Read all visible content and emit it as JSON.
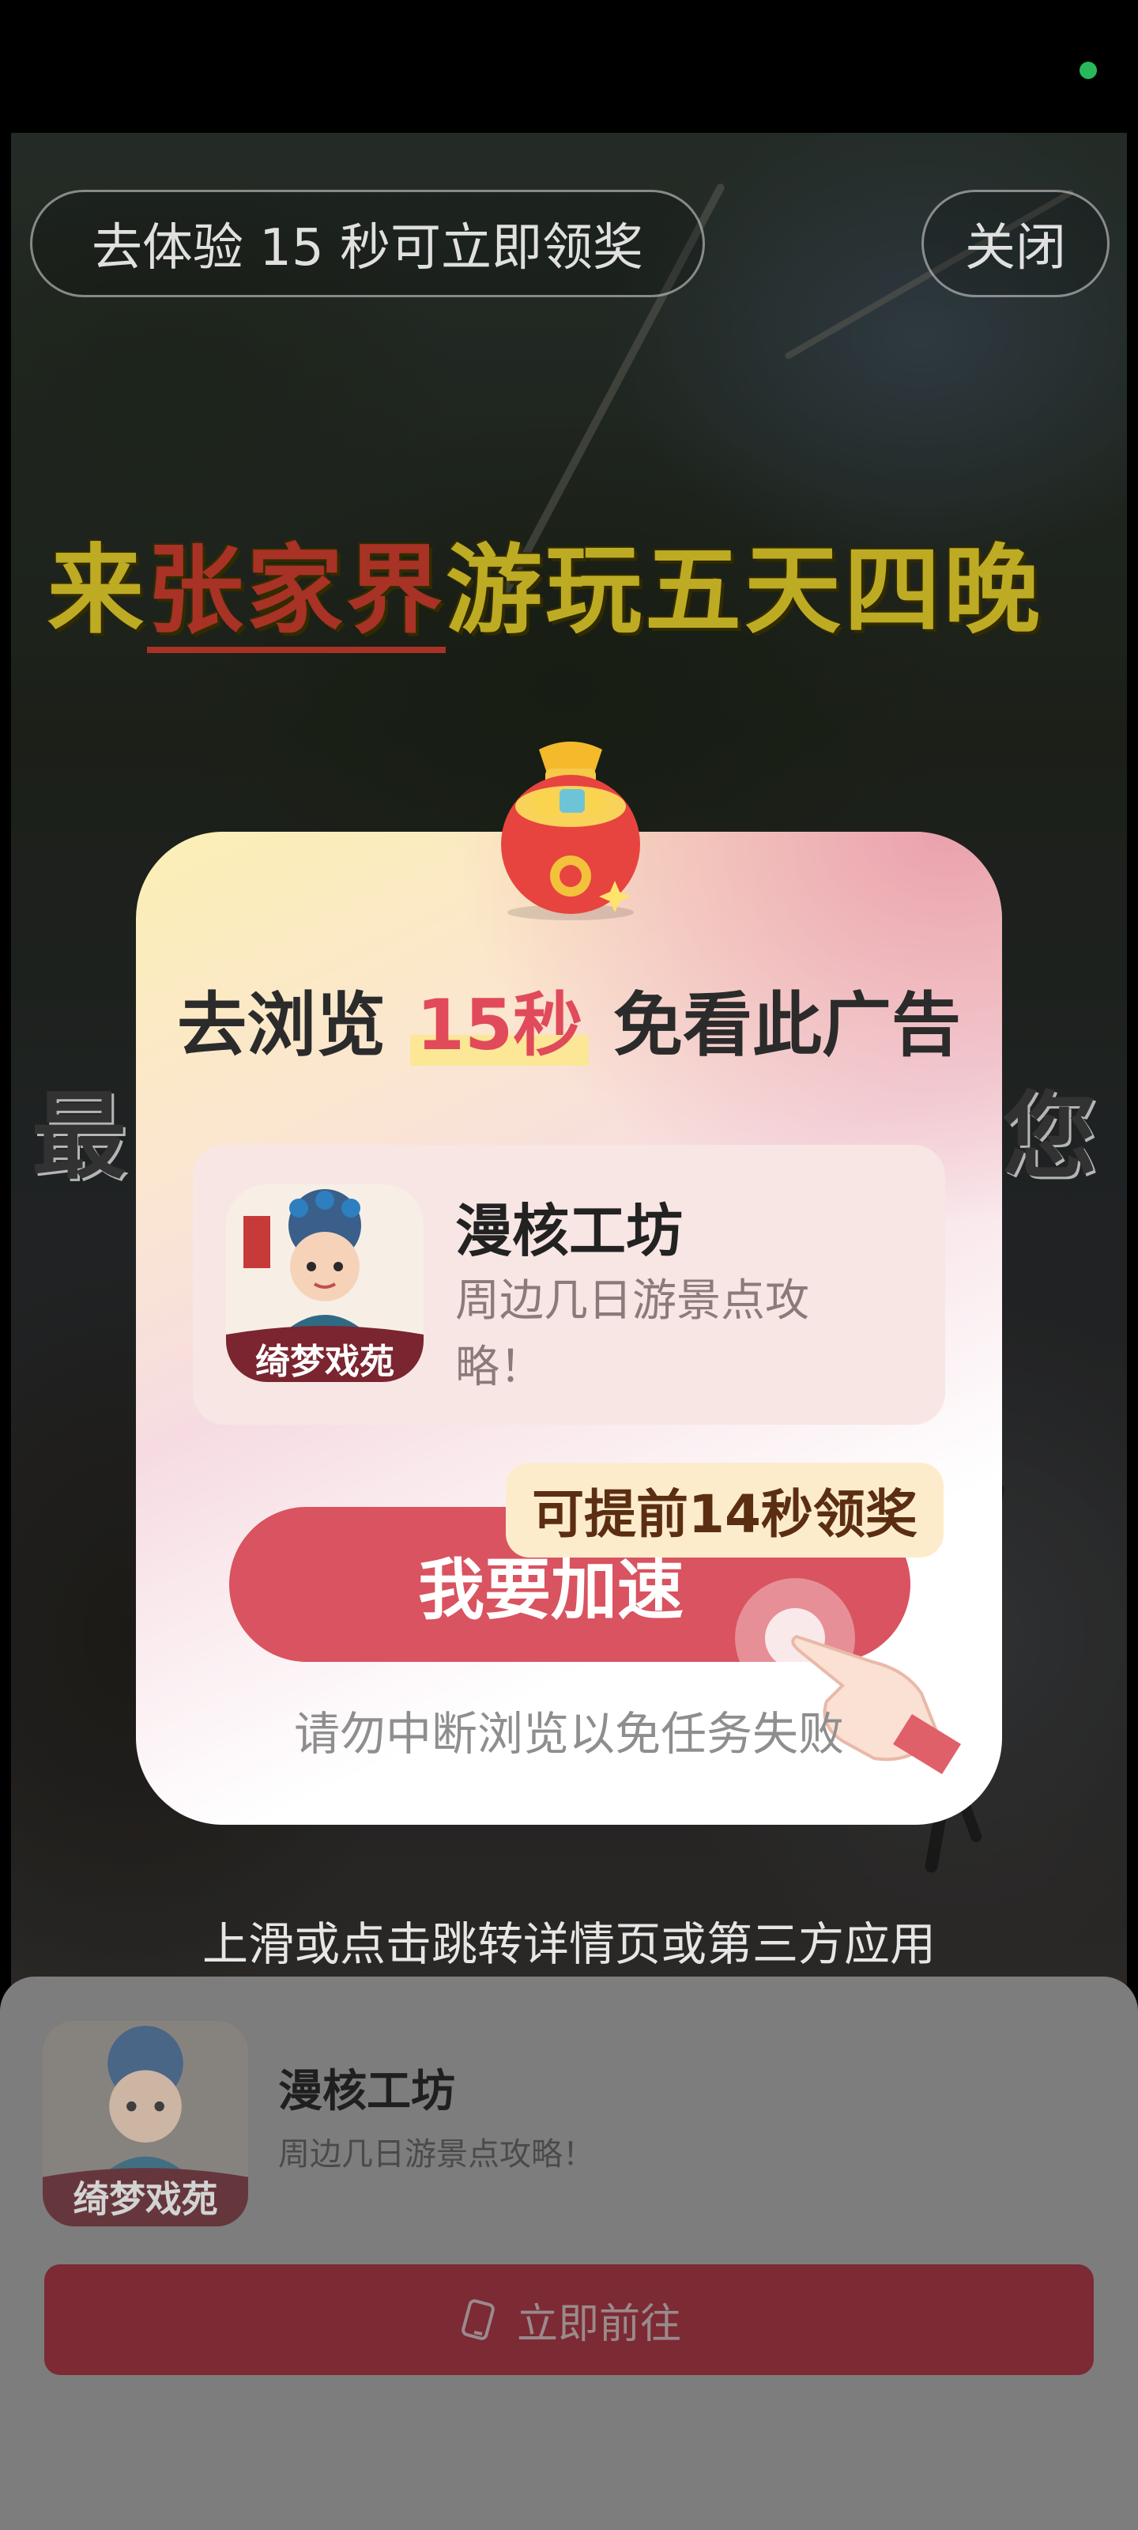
{
  "reward_pill": {
    "label": "去体验 15 秒可立即领奖"
  },
  "close_pill": {
    "label": "关闭"
  },
  "video": {
    "caption_prefix": "来",
    "caption_highlight": "张家界",
    "caption_suffix": "游玩五天四晚",
    "side_left": "最",
    "side_right": "您"
  },
  "modal": {
    "title_prefix": "去浏览 ",
    "title_accent": "15秒",
    "title_suffix": " 免看此广告",
    "app": {
      "name": "漫核工坊",
      "description": "周边几日游景点攻略！",
      "icon": "app-icon-opera-girl"
    },
    "cta_label": "我要加速",
    "tip_badge": "可提前14秒领奖",
    "warning": "请勿中断浏览以免任务失败"
  },
  "jump_hint": "上滑或点击跳转详情页或第三方应用",
  "bottom_card": {
    "app_name": "漫核工坊",
    "app_desc": "周边几日游景点攻略！",
    "go_label": "立即前往"
  },
  "colors": {
    "accent": "#d95360",
    "title_accent": "#e04a5a",
    "badge_bg": "#fdeccc",
    "go_button": "#7c2a34",
    "status_dot": "#2fd36a"
  }
}
